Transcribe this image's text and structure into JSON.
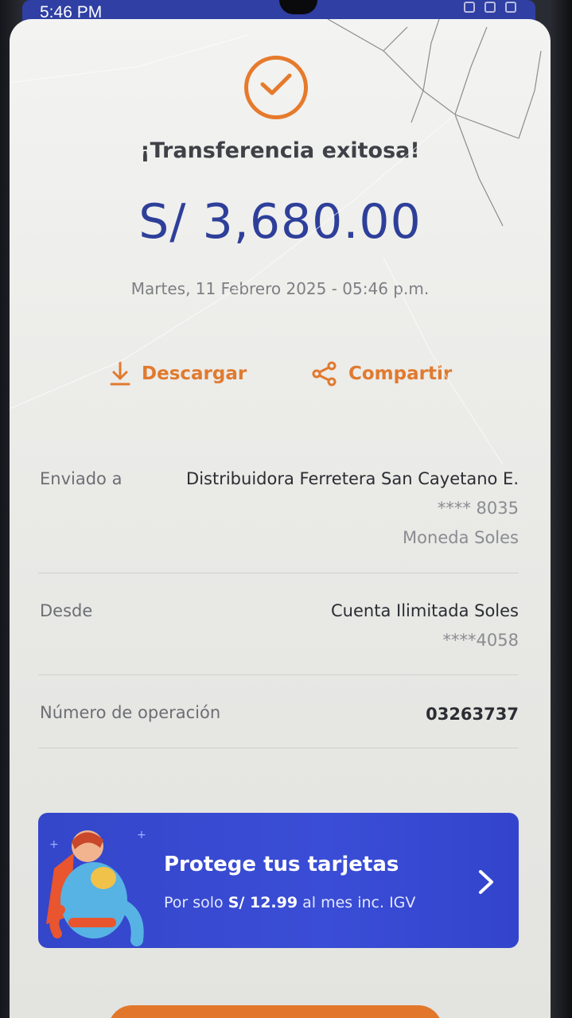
{
  "status_bar": {
    "time": "5:46 PM"
  },
  "receipt": {
    "title": "¡Transferencia exitosa!",
    "amount": "S/ 3,680.00",
    "datetime": "Martes, 11 Febrero 2025 - 05:46 p.m."
  },
  "actions": {
    "download_label": "Descargar",
    "share_label": "Compartir"
  },
  "details": {
    "recipient": {
      "label": "Enviado a",
      "name": "Distribuidora Ferretera San Cayetano E.",
      "account": "**** 8035",
      "currency": "Moneda Soles"
    },
    "source": {
      "label": "Desde",
      "account_name": "Cuenta Ilimitada Soles",
      "account_number": "****4058"
    },
    "operation": {
      "label": "Número de operación",
      "number": "03263737"
    }
  },
  "banner": {
    "title": "Protege tus tarjetas",
    "subtitle_prefix": "Por solo",
    "price": "S/ 12.99",
    "subtitle_suffix": "al mes inc. IGV"
  },
  "colors": {
    "accent_orange": "#e67a2c",
    "brand_blue": "#2e3f9a",
    "banner_blue": "#3a4dd6"
  },
  "icons": {
    "success": "check-circle-icon",
    "download": "download-icon",
    "share": "share-icon",
    "banner_arrow": "chevron-right-icon",
    "banner_art": "superhero-illustration"
  }
}
